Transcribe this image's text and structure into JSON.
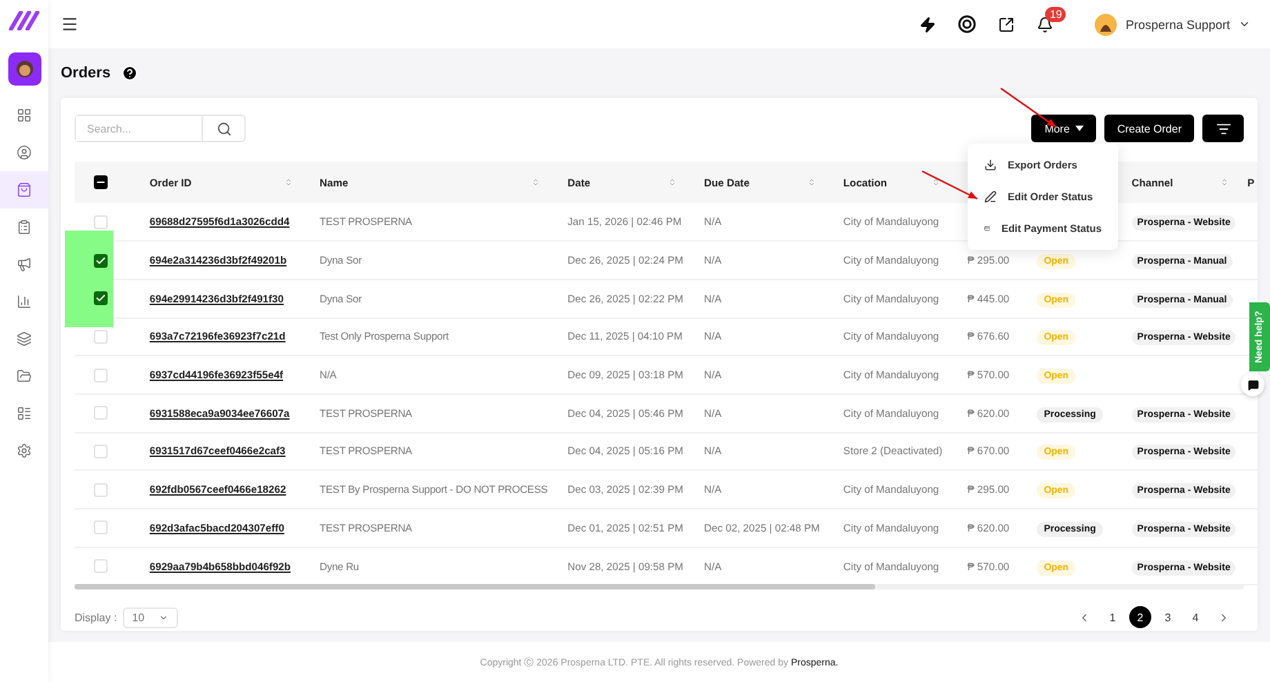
{
  "topbar": {
    "notification_count": "19",
    "user_name": "Prosperna Support"
  },
  "sidebar": {
    "items": [
      {
        "kind": "dashboard",
        "selected": false
      },
      {
        "kind": "customers",
        "selected": false
      },
      {
        "kind": "orders",
        "selected": true
      },
      {
        "kind": "reports",
        "selected": false
      },
      {
        "kind": "marketing",
        "selected": false
      },
      {
        "kind": "analytics",
        "selected": false
      },
      {
        "kind": "layers",
        "selected": false
      },
      {
        "kind": "files",
        "selected": false
      },
      {
        "kind": "apps",
        "selected": false
      },
      {
        "kind": "settings",
        "selected": false
      }
    ]
  },
  "page_title": "Orders",
  "search": {
    "placeholder": "Search..."
  },
  "buttons": {
    "more": "More",
    "create": "Create Order"
  },
  "menu": {
    "items": [
      {
        "kind": "export",
        "label": "Export Orders"
      },
      {
        "kind": "edit",
        "label": "Edit Order Status"
      },
      {
        "kind": "payment",
        "label": "Edit Payment Status"
      }
    ]
  },
  "table": {
    "header_checkbox": {
      "partial": true
    },
    "columns": [
      {
        "label": "Order ID",
        "sortable": true
      },
      {
        "label": "Name",
        "sortable": true
      },
      {
        "label": "Date",
        "sortable": true
      },
      {
        "label": "Due Date",
        "sortable": true
      },
      {
        "label": "Location",
        "sortable": true
      },
      {
        "label": "Channel",
        "sortable": true
      },
      {
        "label": "P"
      }
    ],
    "rows": [
      {
        "checked": false,
        "order_id": "69688d27595f6d1a3026cdd4",
        "name": "TEST PROSPERNA",
        "date": "Jan 15, 2026 | 02:46 PM",
        "due_date": "N/A",
        "location": "City of Mandaluyong",
        "channel": "Prosperna - Website"
      },
      {
        "checked": true,
        "order_id": "694e2a314236d3bf2f49201b",
        "name": "Dyna Sor",
        "date": "Dec 26, 2025 | 02:24 PM",
        "due_date": "N/A",
        "location": "City of Mandaluyong",
        "amount": "₱ 295.00",
        "status": {
          "kind": "open",
          "text": "Open"
        },
        "channel": "Prosperna - Manual"
      },
      {
        "checked": true,
        "order_id": "694e29914236d3bf2f491f30",
        "name": "Dyna Sor",
        "date": "Dec 26, 2025 | 02:22 PM",
        "due_date": "N/A",
        "location": "City of Mandaluyong",
        "amount": "₱ 445.00",
        "status": {
          "kind": "open",
          "text": "Open"
        },
        "channel": "Prosperna - Manual"
      },
      {
        "checked": false,
        "order_id": "693a7c72196fe36923f7c21d",
        "name": "Test Only Prosperna Support",
        "date": "Dec 11, 2025 | 04:10 PM",
        "due_date": "N/A",
        "location": "City of Mandaluyong",
        "amount": "₱ 676.60",
        "status": {
          "kind": "open",
          "text": "Open"
        },
        "channel": "Prosperna - Website"
      },
      {
        "checked": false,
        "order_id": "6937cd44196fe36923f55e4f",
        "name": "N/A",
        "date": "Dec 09, 2025 | 03:18 PM",
        "due_date": "N/A",
        "location": "City of Mandaluyong",
        "amount": "₱ 570.00",
        "status": {
          "kind": "open",
          "text": "Open"
        }
      },
      {
        "checked": false,
        "order_id": "6931588eca9a9034ee76607a",
        "name": "TEST PROSPERNA",
        "date": "Dec 04, 2025 | 05:46 PM",
        "due_date": "N/A",
        "location": "City of Mandaluyong",
        "amount": "₱ 620.00",
        "status": {
          "kind": "processing",
          "text": "Processing"
        },
        "channel": "Prosperna - Website"
      },
      {
        "checked": false,
        "order_id": "6931517d67ceef0466e2caf3",
        "name": "TEST PROSPERNA",
        "date": "Dec 04, 2025 | 05:16 PM",
        "due_date": "N/A",
        "location": "Store 2 (Deactivated)",
        "amount": "₱ 670.00",
        "status": {
          "kind": "open",
          "text": "Open"
        },
        "channel": "Prosperna - Website"
      },
      {
        "checked": false,
        "order_id": "692fdb0567ceef0466e18262",
        "name": "TEST By Prosperna Support - DO NOT PROCESS",
        "date": "Dec 03, 2025 | 02:39 PM",
        "due_date": "N/A",
        "location": "City of Mandaluyong",
        "amount": "₱ 295.00",
        "status": {
          "kind": "open",
          "text": "Open"
        },
        "channel": "Prosperna - Website"
      },
      {
        "checked": false,
        "order_id": "692d3afac5bacd204307eff0",
        "name": "TEST PROSPERNA",
        "date": "Dec 01, 2025 | 02:51 PM",
        "due_date": "Dec 02, 2025 | 02:48 PM",
        "location": "City of Mandaluyong",
        "amount": "₱ 620.00",
        "status": {
          "kind": "processing",
          "text": "Processing"
        },
        "channel": "Prosperna - Website"
      },
      {
        "checked": false,
        "order_id": "6929aa79b4b658bbd046f92b",
        "name": "Dyne Ru",
        "date": "Nov 28, 2025 | 09:58 PM",
        "due_date": "N/A",
        "location": "City of Mandaluyong",
        "amount": "₱ 570.00",
        "status": {
          "kind": "open",
          "text": "Open"
        },
        "channel": "Prosperna - Website"
      }
    ]
  },
  "display": {
    "label": "Display :",
    "value": "10"
  },
  "pagination": {
    "pages": [
      {
        "label": "1",
        "selected": false
      },
      {
        "label": "2",
        "selected": true
      },
      {
        "label": "3",
        "selected": false
      },
      {
        "label": "4",
        "selected": false
      }
    ]
  },
  "footer": "Copyright Ⓒ 2026 Prosperna LTD. PTE. All rights reserved. Powered by **Prosperna.**",
  "help_tab": "Need help?"
}
